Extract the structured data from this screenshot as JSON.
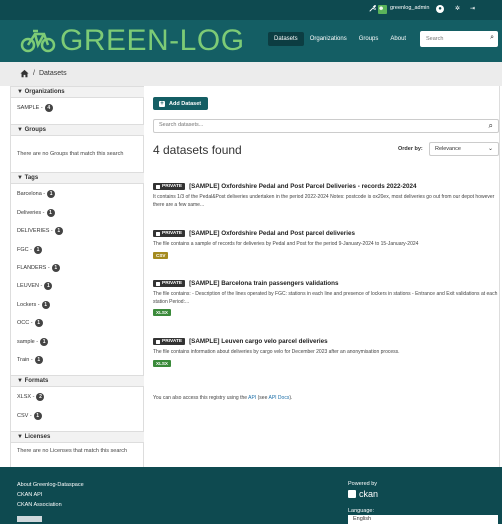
{
  "account": {
    "username": "greenlog_admin"
  },
  "brand": {
    "logo_text": "GREEN-LOG"
  },
  "nav": {
    "items": [
      "Datasets",
      "Organizations",
      "Groups",
      "About"
    ],
    "search_placeholder": "Search"
  },
  "breadcrumb": {
    "current": "Datasets"
  },
  "sidebar": {
    "organizations": {
      "heading": "Organizations",
      "items": [
        {
          "label": "SAMPLE",
          "count": "4"
        }
      ]
    },
    "groups": {
      "heading": "Groups",
      "empty": "There are no Groups that match this search"
    },
    "tags": {
      "heading": "Tags",
      "items": [
        {
          "label": "Barcelona",
          "count": "1"
        },
        {
          "label": "Deliveries",
          "count": "1"
        },
        {
          "label": "DELIVERIES",
          "count": "1"
        },
        {
          "label": "FGC",
          "count": "1"
        },
        {
          "label": "FLANDERS",
          "count": "1"
        },
        {
          "label": "LEUVEN",
          "count": "1"
        },
        {
          "label": "Lockers",
          "count": "1"
        },
        {
          "label": "OCC",
          "count": "1"
        },
        {
          "label": "sample",
          "count": "1"
        },
        {
          "label": "Train",
          "count": "1"
        }
      ]
    },
    "formats": {
      "heading": "Formats",
      "items": [
        {
          "label": "XLSX",
          "count": "2"
        },
        {
          "label": "CSV",
          "count": "1"
        }
      ]
    },
    "licenses": {
      "heading": "Licenses",
      "empty": "There are no Licenses that match this search"
    }
  },
  "main": {
    "add_dataset": "Add Dataset",
    "search_placeholder": "Search datasets...",
    "found": "4 datasets found",
    "order_by_label": "Order by:",
    "order_by_value": "Relevance",
    "private_label": "PRIVATE",
    "datasets": [
      {
        "title": "[SAMPLE] Oxfordshire Pedal and Post Parcel Deliveries - records 2022-2024",
        "notes": "It contains 1/3 of the Pedal&Post deliveries undertaken in the period 2022-2024 Notes: postcode is ox20ex, most deliveries go out from our depot however there are a few same...",
        "format": ""
      },
      {
        "title": "[SAMPLE] Oxfordshire Pedal and Post parcel deliveries",
        "notes": "The file contains a sample of records for deliveries by Pedal and Post for the period 9-January-2024 to 15-January-2024",
        "format": "CSV"
      },
      {
        "title": "[SAMPLE] Barcelona train passengers validations",
        "notes": "The file contains: - Description of the lines operated by FGC: stations in each line and presence of lockers in stations - Entrance and Exit validations at each station Period:...",
        "format": "XLSX"
      },
      {
        "title": "[SAMPLE] Leuven cargo velo parcel deliveries",
        "notes": "The file contains information about deliveries by cargo velo for December 2023 after an anonymisation process.",
        "format": "XLSX"
      }
    ],
    "api_note_prefix": "You can also access this registry using the",
    "api_link": "API",
    "api_note_mid": "(see",
    "api_docs_link": "API Docs",
    "api_note_suffix": ")."
  },
  "footer": {
    "links": [
      "About Greenlog-Dataspace",
      "CKAN API",
      "CKAN Association"
    ],
    "powered_by": "Powered by",
    "ckan": "ckan",
    "language_label": "Language:",
    "language_value": "English"
  },
  "colors": {
    "header_dark": "#0e4a50",
    "masthead": "#145e64",
    "logo_green": "#7dcb76",
    "csv_badge": "#a48a1e",
    "xlsx_badge": "#3a8a3a"
  }
}
